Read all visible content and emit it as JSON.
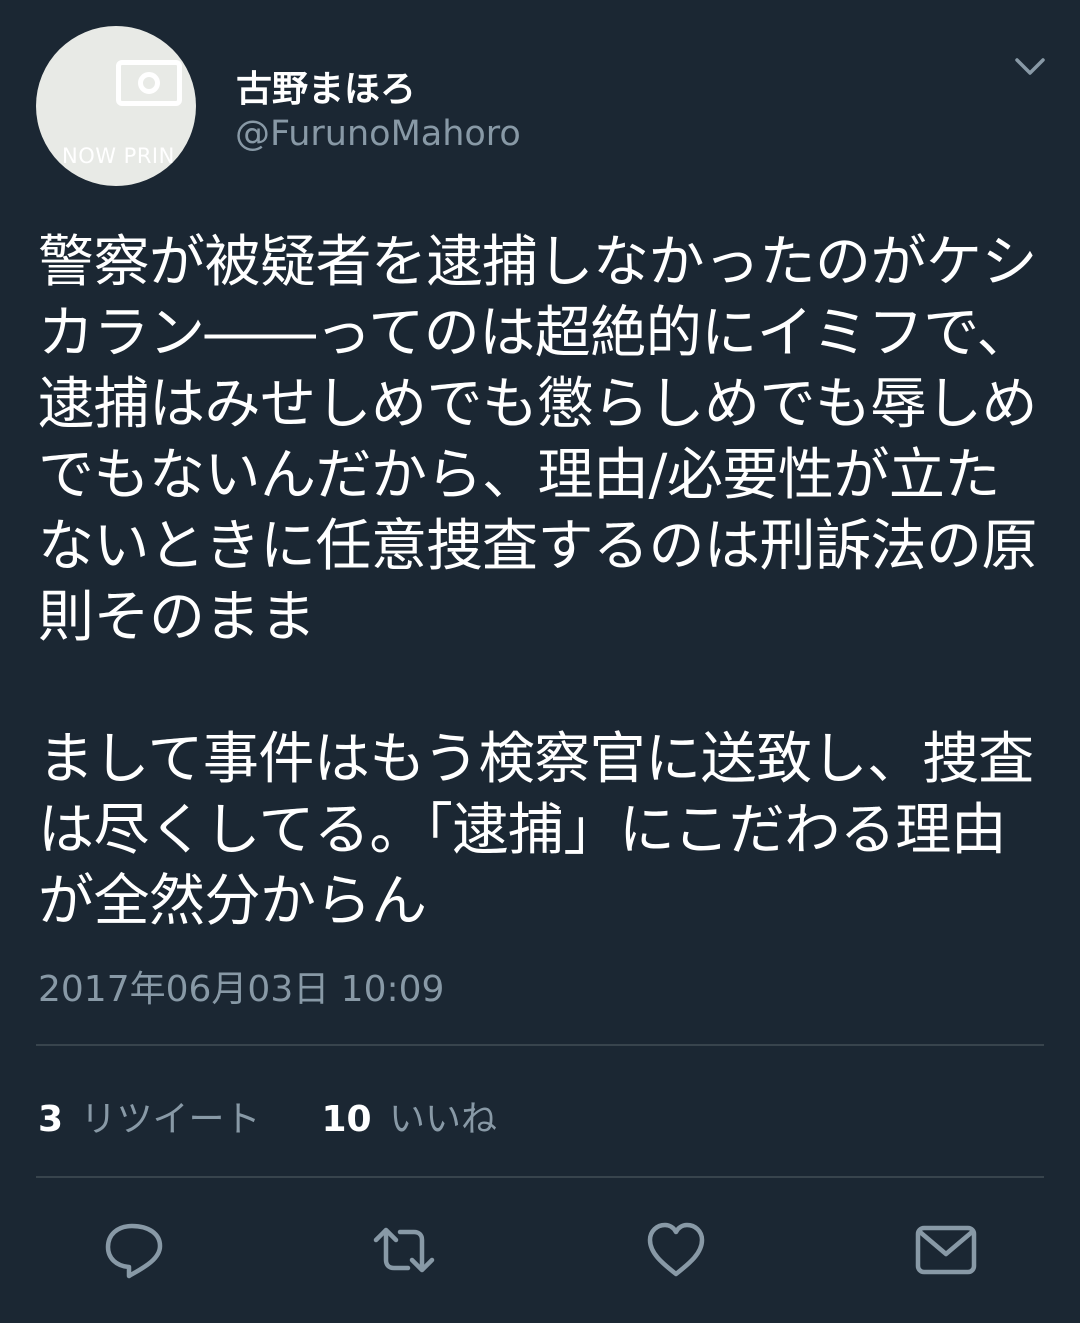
{
  "tweet": {
    "author": {
      "display_name": "古野まほろ",
      "handle": "@FurunoMahoro",
      "avatar_text": "NOW PRIN"
    },
    "body": "警察が被疑者を逮捕しなかったのがケシカラン――ってのは超絶的にイミフで、逮捕はみせしめでも懲らしめでも辱しめでもないんだから、理由/必要性が立たないときに任意捜査するのは刑訴法の原則そのまま\n\nまして事件はもう検察官に送致し、捜査は尽くしてる。「逮捕」にこだわる理由が全然分からん",
    "timestamp": "2017年06月03日 10:09",
    "stats": {
      "retweets_count": "3",
      "retweets_label": "リツイート",
      "likes_count": "10",
      "likes_label": "いいね"
    }
  },
  "icons": {
    "menu": "chevron-down-icon",
    "reply": "reply-icon",
    "retweet": "retweet-icon",
    "like": "heart-icon",
    "message": "envelope-icon"
  },
  "colors": {
    "background": "#1b2733",
    "text": "#ffffff",
    "secondary_text": "#8899a6",
    "divider": "#38444d"
  }
}
